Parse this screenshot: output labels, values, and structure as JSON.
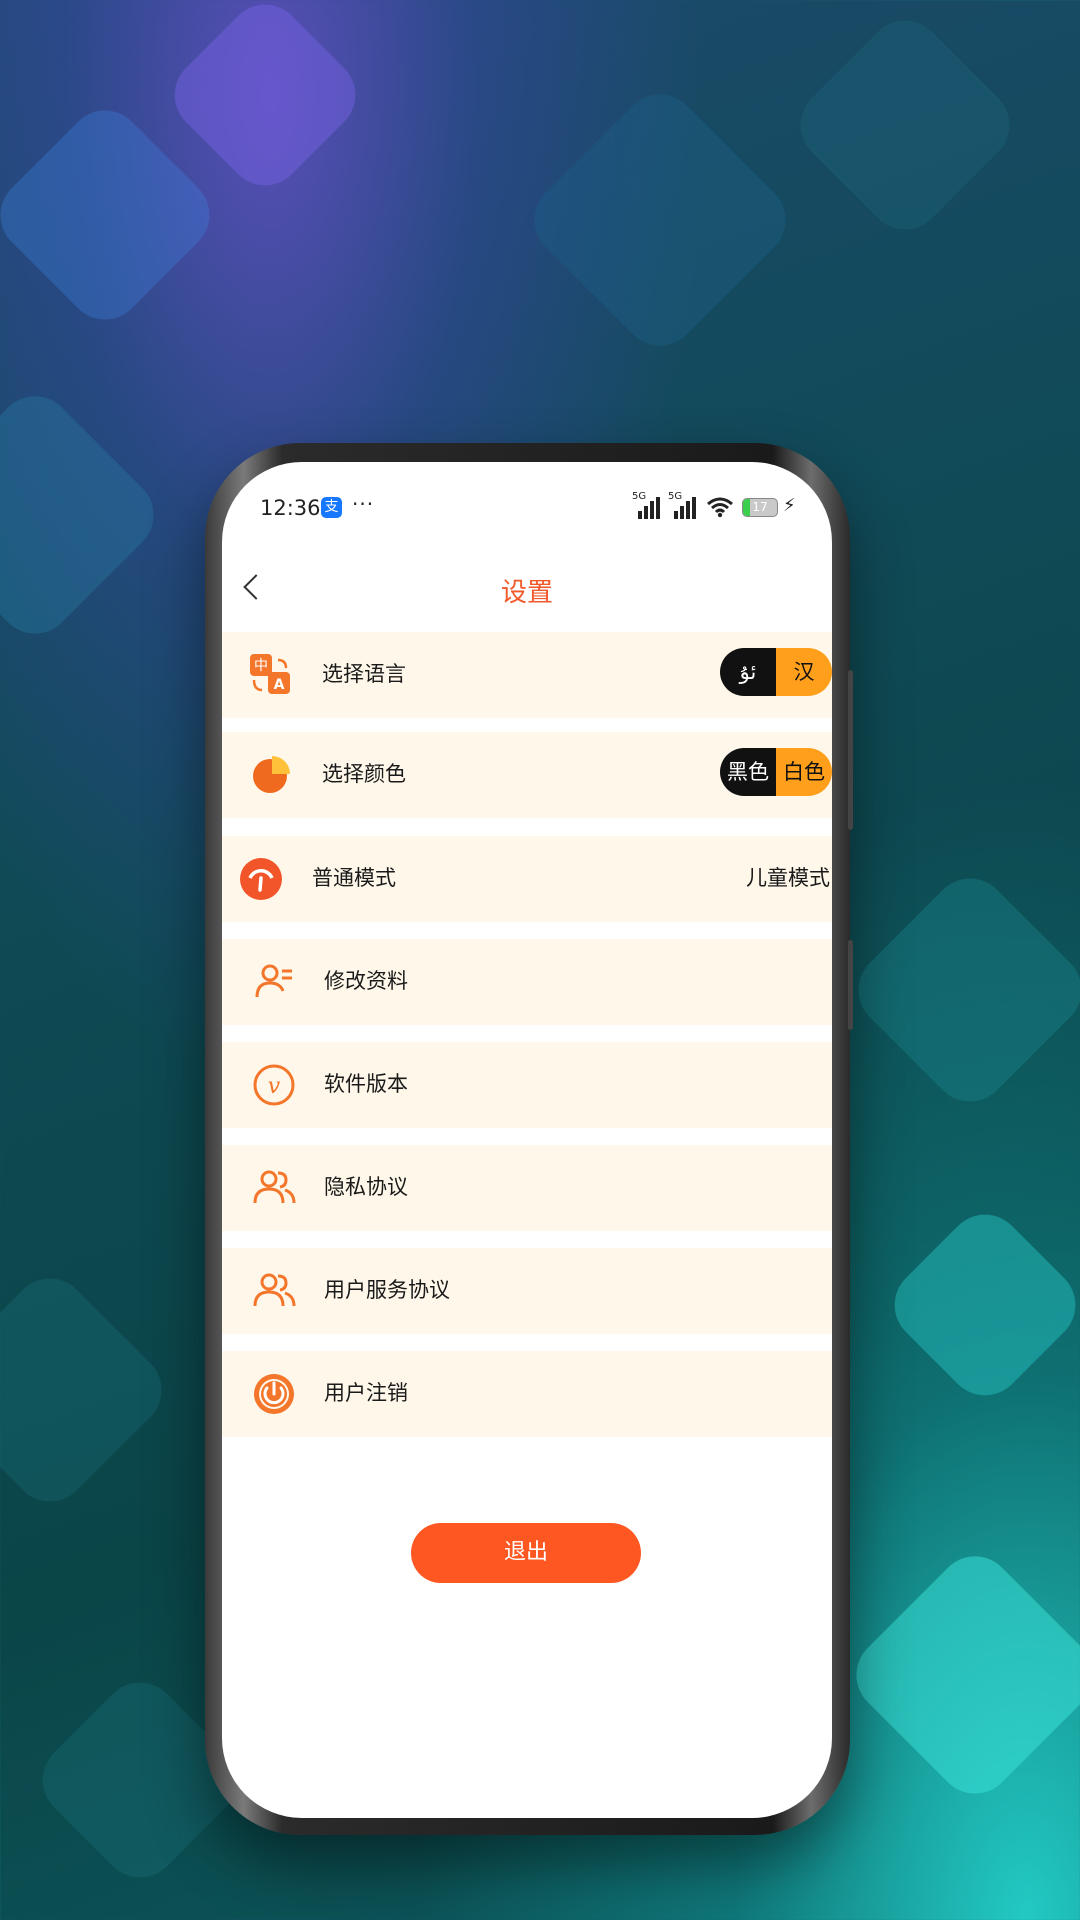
{
  "status_bar": {
    "time": "12:36",
    "alipay_label": "支",
    "more": "···",
    "network_1": "5G",
    "network_2": "5G",
    "battery": "17"
  },
  "header": {
    "title": "设置"
  },
  "settings": {
    "language": {
      "label": "选择语言",
      "option_1": "ئۇ",
      "option_2": "汉"
    },
    "color": {
      "label": "选择颜色",
      "option_1": "黑色",
      "option_2": "白色"
    },
    "mode": {
      "label": "普通模式",
      "alt": "儿童模式"
    },
    "profile": {
      "label": "修改资料"
    },
    "version": {
      "label": "软件版本"
    },
    "privacy": {
      "label": "隐私协议"
    },
    "service": {
      "label": "用户服务协议"
    },
    "deregister": {
      "label": "用户注销"
    }
  },
  "logout_label": "退出",
  "colors": {
    "accent": "#f0592a",
    "row_bg": "#fff8ea",
    "toggle_active": "#ff9f1c"
  }
}
